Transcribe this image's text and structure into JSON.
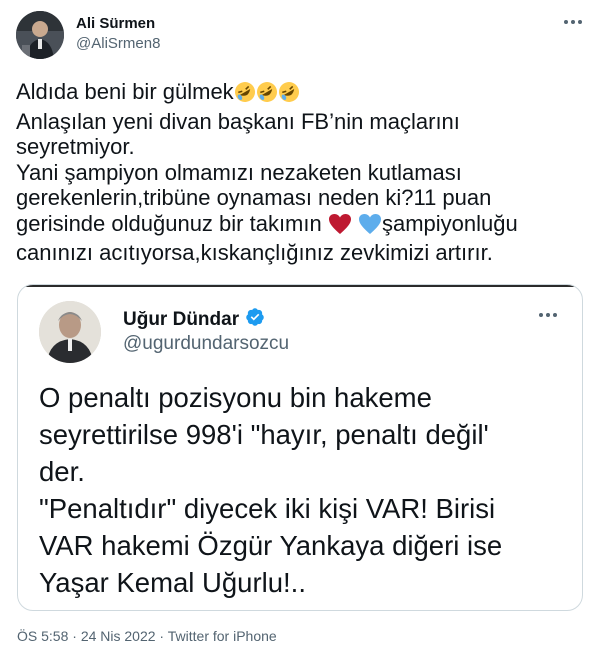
{
  "tweet": {
    "author": {
      "name": "Ali Sürmen",
      "handle": "@AliSrmen8"
    },
    "text_lines": [
      "Aldıda beni bir gülmek",
      "Anlaşılan yeni divan başkanı FB’nin maçlarını",
      "seyretmiyor.",
      "Yani şampiyon olmamızı nezaketen kutlaması",
      "gerekenlerin,tribüne oynaması neden ki?11 puan",
      "gerisinde olduğunuz bir takımın",
      "şampiyonluğu",
      "canınızı acıtıyorsa,kıskançlığınız zevkimizi artırır."
    ],
    "emojis": {
      "laughing": "rolling-on-floor-laughing-icon",
      "red_heart": "red-heart-icon",
      "blue_heart": "blue-heart-icon"
    },
    "meta": {
      "time": "ÖS 5:58",
      "separator": " · ",
      "date": "24 Nis 2022",
      "source": "Twitter for iPhone"
    }
  },
  "quoted": {
    "author": {
      "name": "Uğur Dündar",
      "handle": "@ugurdundarsozcu",
      "verified": true
    },
    "text_lines": [
      "O penaltı pozisyonu bin hakeme",
      "seyrettirilse 998'i \"hayır, penaltı değil'",
      "der.",
      "\"Penaltıdır\" diyecek iki kişi VAR! Birisi",
      "VAR hakemi Özgür Yankaya diğeri ise",
      "Yaşar Kemal Uğurlu!.."
    ]
  },
  "colors": {
    "text": "#0f1419",
    "secondary": "#536471",
    "border": "#cfd9de",
    "verified": "#1d9bf0",
    "heart_red": "#be1931",
    "heart_blue": "#5dadec"
  }
}
